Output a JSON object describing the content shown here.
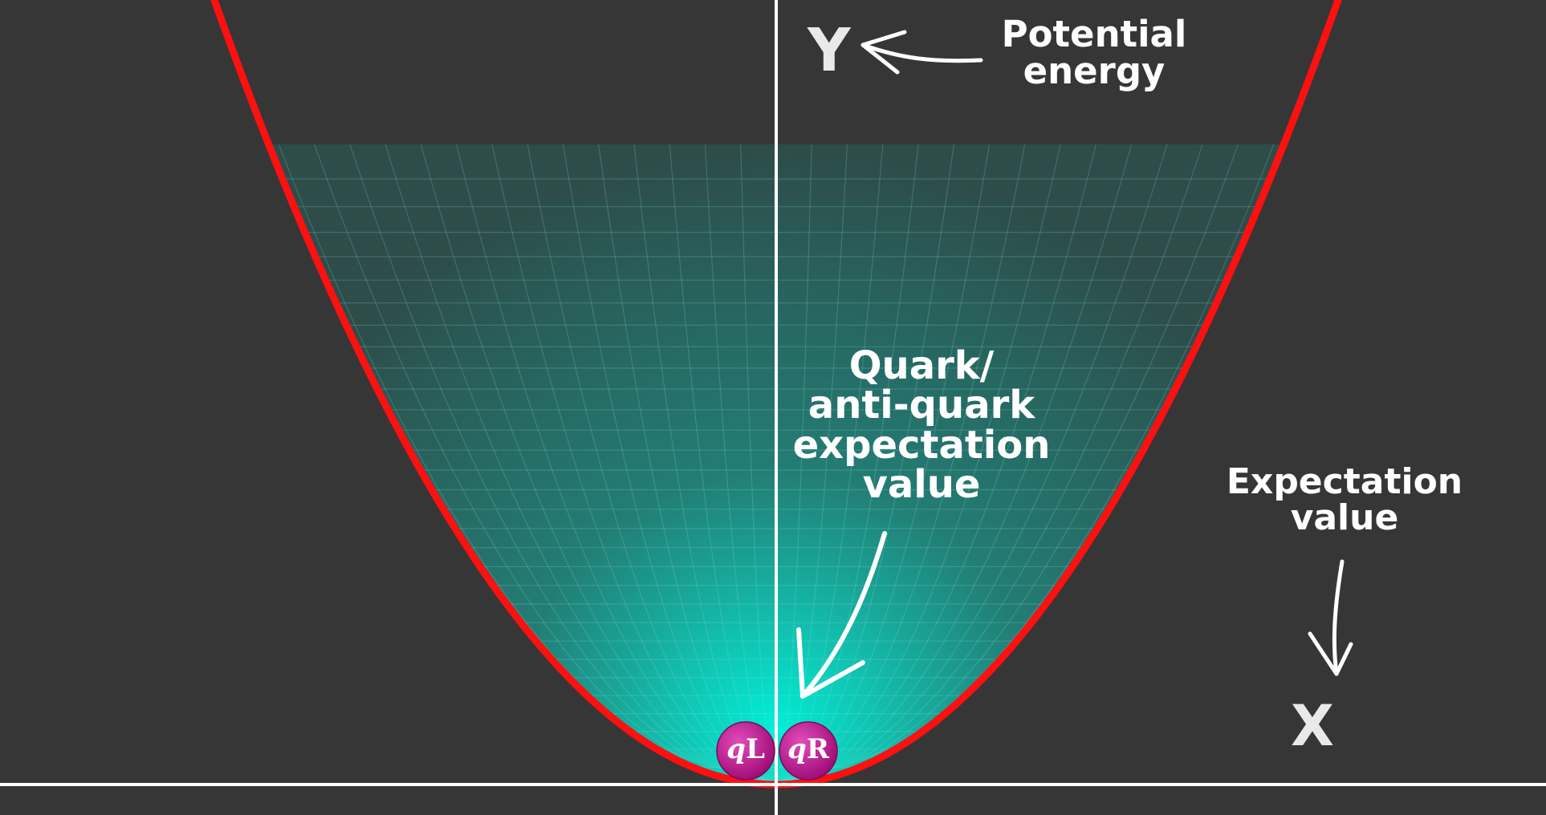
{
  "labels": {
    "y_axis": "Y",
    "x_axis": "X",
    "potential_energy": [
      "Potential",
      "energy"
    ],
    "quark_expectation": [
      "Quark/",
      "anti-quark",
      "expectation",
      "value"
    ],
    "expectation_value": [
      "Expectation",
      "value"
    ]
  },
  "particles": [
    {
      "italic": "q",
      "suffix": "L"
    },
    {
      "italic": "q",
      "suffix": "R"
    }
  ],
  "colors": {
    "background": "#363636",
    "curve": "#ff1010",
    "surface": "#1f9e93",
    "surface_glow": "#00f0d8",
    "axes": "#ffffff",
    "particle": "#c0138f"
  }
}
